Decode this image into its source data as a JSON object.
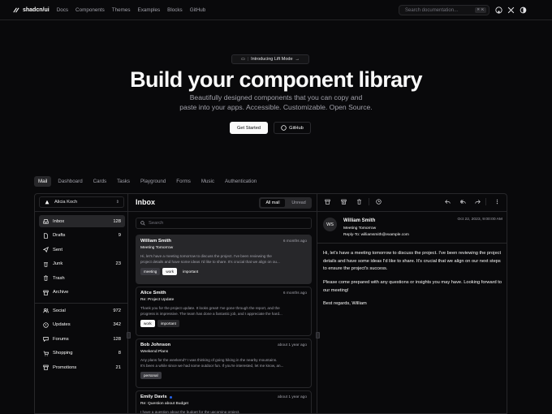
{
  "nav": {
    "brand": "shadcn/ui",
    "links": [
      "Docs",
      "Components",
      "Themes",
      "Examples",
      "Blocks",
      "GitHub"
    ],
    "search_placeholder": "Search documentation...",
    "search_shortcut": "⌘ K"
  },
  "hero": {
    "badge": "Introducing Lift Mode",
    "title": "Build your component library",
    "subtitle_line1": "Beautifully designed components that you can copy and",
    "subtitle_line2": "paste into your apps. Accessible. Customizable. Open Source.",
    "primary_button": "Get Started",
    "secondary_button": "GitHub"
  },
  "examples_tabs": [
    {
      "label": "Mail",
      "active": true
    },
    {
      "label": "Dashboard",
      "active": false
    },
    {
      "label": "Cards",
      "active": false
    },
    {
      "label": "Tasks",
      "active": false
    },
    {
      "label": "Playground",
      "active": false
    },
    {
      "label": "Forms",
      "active": false
    },
    {
      "label": "Music",
      "active": false
    },
    {
      "label": "Authentication",
      "active": false
    }
  ],
  "mail": {
    "account": "Alicia Koch",
    "folders": [
      {
        "label": "Inbox",
        "count": "128",
        "icon": "inbox-icon",
        "selected": true
      },
      {
        "label": "Drafts",
        "count": "9",
        "icon": "file-icon",
        "selected": false
      },
      {
        "label": "Sent",
        "count": "",
        "icon": "send-icon",
        "selected": false
      },
      {
        "label": "Junk",
        "count": "23",
        "icon": "junk-icon",
        "selected": false
      },
      {
        "label": "Trash",
        "count": "",
        "icon": "trash-icon",
        "selected": false
      },
      {
        "label": "Archive",
        "count": "",
        "icon": "archive-icon",
        "selected": false
      }
    ],
    "categories": [
      {
        "label": "Social",
        "count": "972",
        "icon": "users-icon"
      },
      {
        "label": "Updates",
        "count": "342",
        "icon": "alert-icon"
      },
      {
        "label": "Forums",
        "count": "128",
        "icon": "message-icon"
      },
      {
        "label": "Shopping",
        "count": "8",
        "icon": "cart-icon"
      },
      {
        "label": "Promotions",
        "count": "21",
        "icon": "archive-icon"
      }
    ],
    "list": {
      "title": "Inbox",
      "filter_all": "All mail",
      "filter_unread": "Unread",
      "search_placeholder": "Search",
      "items": [
        {
          "name": "William Smith",
          "date": "6 months ago",
          "subject": "Meeting Tomorrow",
          "preview1": "Hi, let's have a meeting tomorrow to discuss the project. I've been reviewing the",
          "preview2": "project details and have some ideas I'd like to share. It's crucial that we align on ou...",
          "tags": [
            "meeting",
            "work",
            "important"
          ],
          "selected": true,
          "unread": false
        },
        {
          "name": "Alice Smith",
          "date": "6 months ago",
          "subject": "Re: Project Update",
          "preview1": "Thank you for the project update. It looks great! I've gone through the report, and the",
          "preview2": "progress is impressive. The team has done a fantastic job, and I appreciate the hard...",
          "tags": [
            "work",
            "important"
          ],
          "selected": false,
          "unread": false
        },
        {
          "name": "Bob Johnson",
          "date": "about 1 year ago",
          "subject": "Weekend Plans",
          "preview1": "Any plans for the weekend? I was thinking of going hiking in the nearby mountains.",
          "preview2": "It's been a while since we had some outdoor fun. If you're interested, let me know, an...",
          "tags": [
            "personal"
          ],
          "selected": false,
          "unread": false
        },
        {
          "name": "Emily Davis",
          "date": "about 1 year ago",
          "subject": "Re: Question about Budget",
          "preview1": "I have a question about the budget for the upcoming project.",
          "preview2": "",
          "tags": [],
          "selected": false,
          "unread": true
        }
      ]
    },
    "reader": {
      "initials": "WS",
      "name": "William Smith",
      "subject": "Meeting Tomorrow",
      "reply_to": "Reply-To: williamsmith@example.com",
      "date": "Oct 22, 2023, 9:00:00 AM",
      "para1": "Hi, let's have a meeting tomorrow to discuss the project. I've been reviewing the project details and have some ideas I'd like to share. It's crucial that we align on our next steps to ensure the project's success.",
      "para2": "Please come prepared with any questions or insights you may have. Looking forward to our meeting!",
      "para3": "Best regards, William"
    }
  }
}
